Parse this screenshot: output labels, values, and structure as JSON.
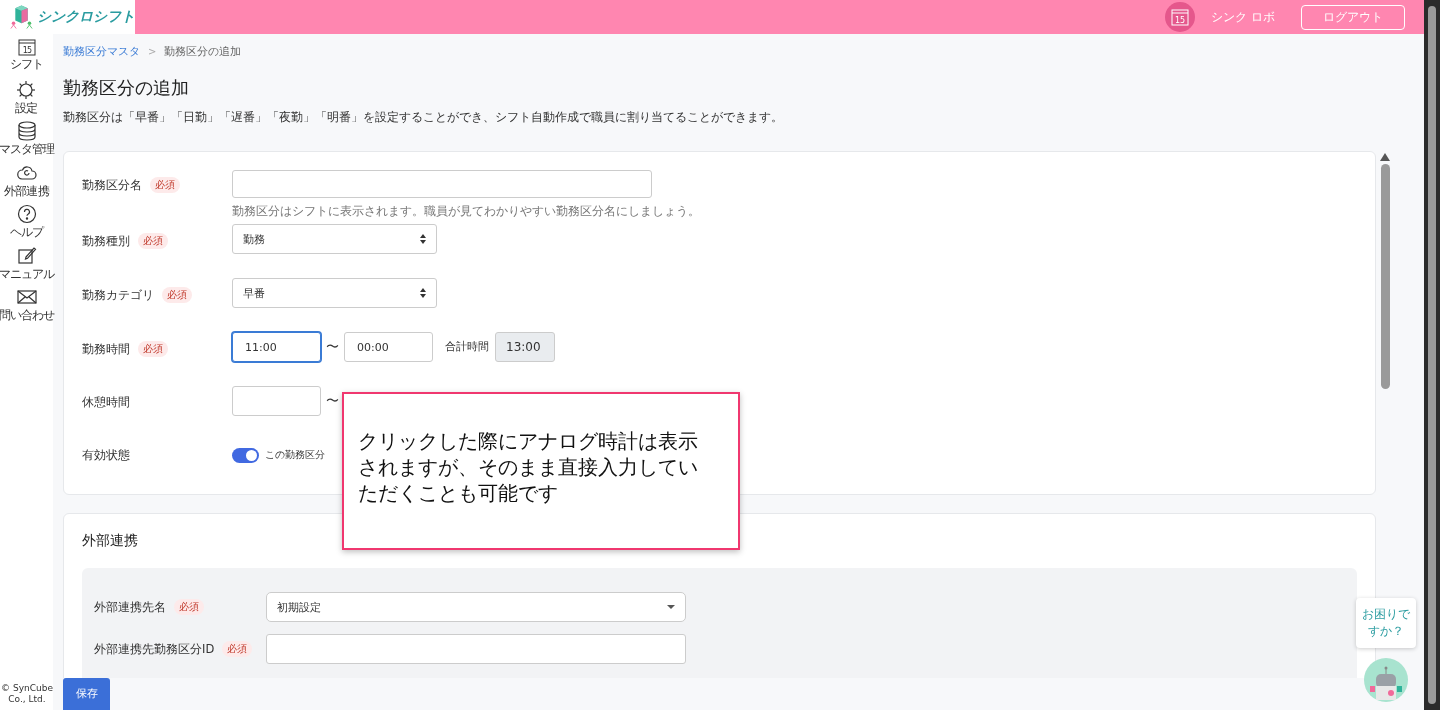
{
  "header": {
    "logo_text": "シンクロシフト",
    "calendar_day": "15",
    "user_name": "シンク ロボ",
    "logout": "ログアウト"
  },
  "sidebar": {
    "items": [
      {
        "label": "シフト",
        "badge": "15"
      },
      {
        "label": "設定"
      },
      {
        "label": "マスタ管理"
      },
      {
        "label": "外部連携"
      },
      {
        "label": "ヘルプ"
      },
      {
        "label": "マニュアル"
      },
      {
        "label": "問い合わせ"
      }
    ],
    "copyright": "© SynCube Co., Ltd."
  },
  "breadcrumb": {
    "items": [
      {
        "label": "勤務区分マスタ",
        "kind": "link"
      },
      {
        "label": "勤務区分の追加",
        "kind": "current"
      }
    ],
    "separator": ">"
  },
  "title": "勤務区分の追加",
  "description": "勤務区分は「早番」「日勤」「遅番」「夜勤」「明番」を設定することができ、シフト自動作成で職員に割り当てることができます。",
  "form": {
    "fields": [
      {
        "kind": "text",
        "label": "勤務区分名",
        "required": "必須",
        "hint": "勤務区分はシフトに表示されます。職員が見てわかりやすい勤務区分名にしましょう。"
      },
      {
        "kind": "select",
        "label": "勤務種別",
        "required": "必須",
        "value": "勤務"
      },
      {
        "kind": "select",
        "label": "勤務カテゴリ",
        "required": "必須",
        "value": "早番"
      },
      {
        "kind": "time_range",
        "label": "勤務時間",
        "required": "必須",
        "start": "11:00",
        "end": "00:00",
        "separator": "〜",
        "total_label": "合計時間",
        "total": "13:00",
        "focused": true
      },
      {
        "kind": "break_range",
        "label": "休憩時間",
        "separator": "〜"
      },
      {
        "kind": "toggle",
        "label": "有効状態",
        "on": true,
        "text": "この勤務区分"
      }
    ]
  },
  "integration": {
    "title": "外部連携",
    "fields": [
      {
        "kind": "dropdown",
        "label": "外部連携先名",
        "required": "必須",
        "value": "初期設定"
      },
      {
        "kind": "text",
        "label": "外部連携先勤務区分ID",
        "required": "必須"
      }
    ]
  },
  "save_button": "保存",
  "callout": "クリックした際にアナログ時計は表示されますが、そのまま直接入力していただくことも可能です",
  "helper": {
    "bubble": "お困りですか？"
  }
}
